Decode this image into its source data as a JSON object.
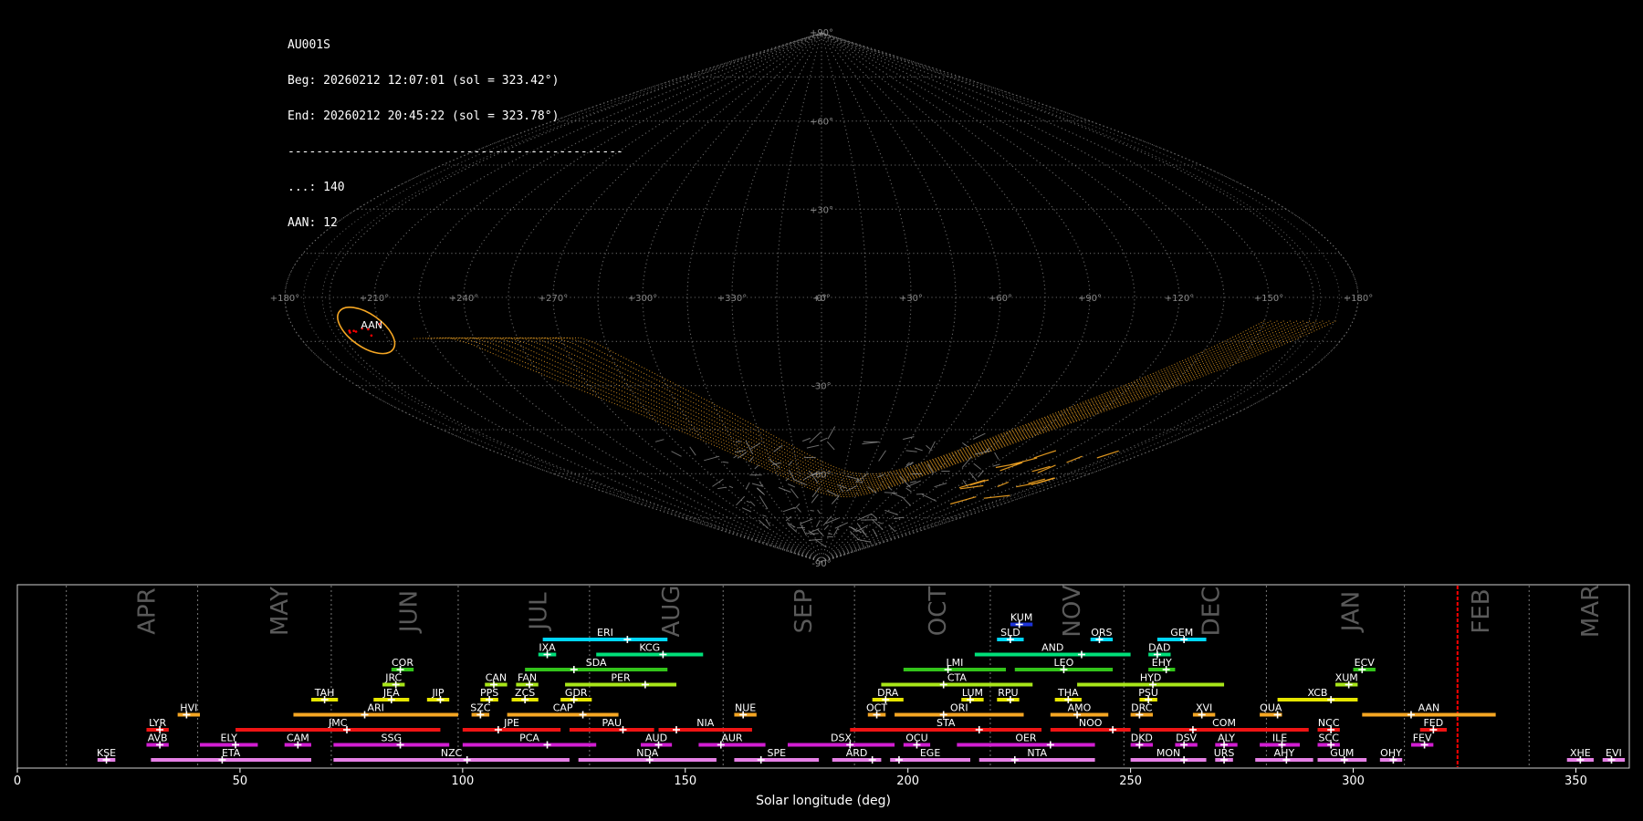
{
  "info": {
    "camera": "AU001S",
    "begin": "Beg: 20260212 12:07:01 (sol = 323.42°)",
    "end": "End: 20260212 20:45:22 (sol = 323.78°)",
    "separator": "-----------------------------------------------",
    "count_sporadic": "...: 140",
    "count_shower": "AAN: 12"
  },
  "chart_data": [
    {
      "type": "scatter",
      "projection": "sinusoidal",
      "grid": true,
      "lat_labels": [
        "+90°",
        "+60°",
        "+30°",
        "0°",
        "-30°",
        "-60°",
        "-90°"
      ],
      "lat_values": [
        90,
        60,
        30,
        0,
        -30,
        -60,
        -90
      ],
      "lon_labels": [
        "+180°",
        "+150°",
        "+120°",
        "+90°",
        "+60°",
        "+30°",
        "+0°",
        "+330°",
        "+300°",
        "+270°",
        "+240°",
        "+210°",
        "+180°"
      ],
      "lon_values": [
        180,
        150,
        120,
        90,
        60,
        30,
        0,
        330,
        300,
        270,
        240,
        210,
        180
      ],
      "radiant": {
        "label": "AAN",
        "lon": 165,
        "lat": -10,
        "color": "#ff0000",
        "ellipse_color": "#f5a623"
      },
      "colors": {
        "grid": "#888888",
        "sporadic": "#9a9a9a",
        "shower": "#f5a623"
      }
    },
    {
      "type": "timeline",
      "xlabel": "Solar longitude (deg)",
      "xlim": [
        0,
        362
      ],
      "xticks": [
        0,
        50,
        100,
        150,
        200,
        250,
        300,
        350
      ],
      "current_sol": 323.42,
      "current_color": "#ff0000",
      "months": [
        {
          "name": "APR",
          "sol": 11
        },
        {
          "name": "MAY",
          "sol": 40.5
        },
        {
          "name": "JUN",
          "sol": 70.5
        },
        {
          "name": "JUL",
          "sol": 99
        },
        {
          "name": "AUG",
          "sol": 128.5
        },
        {
          "name": "SEP",
          "sol": 158.5
        },
        {
          "name": "OCT",
          "sol": 188
        },
        {
          "name": "NOV",
          "sol": 218.5
        },
        {
          "name": "DEC",
          "sol": 248.5
        },
        {
          "name": "JAN",
          "sol": 280.5
        },
        {
          "name": "FEB",
          "sol": 311.5
        },
        {
          "name": "MAR",
          "sol": 339.5
        }
      ],
      "showers": [
        {
          "name": "KUM",
          "start": 223,
          "end": 228,
          "peak": 225,
          "row": 9,
          "color": "#1d33d9"
        },
        {
          "name": "ERI",
          "start": 118,
          "end": 146,
          "peak": 137,
          "row": 8,
          "color": "#00d7ff"
        },
        {
          "name": "SLD",
          "start": 220,
          "end": 226,
          "peak": 223,
          "row": 8,
          "color": "#00d7ff"
        },
        {
          "name": "ORS",
          "start": 241,
          "end": 246,
          "peak": 243,
          "row": 8,
          "color": "#00d7ff"
        },
        {
          "name": "GEM",
          "start": 256,
          "end": 267,
          "peak": 262,
          "row": 8,
          "color": "#00d7ff"
        },
        {
          "name": "IXA",
          "start": 117,
          "end": 121,
          "peak": 119,
          "row": 7,
          "color": "#00e07a"
        },
        {
          "name": "KCG",
          "start": 130,
          "end": 154,
          "peak": 145,
          "row": 7,
          "color": "#00e07a"
        },
        {
          "name": "AND",
          "start": 215,
          "end": 250,
          "peak": 239,
          "row": 7,
          "color": "#00e07a"
        },
        {
          "name": "DAD",
          "start": 254,
          "end": 259,
          "peak": 256,
          "row": 7,
          "color": "#00e07a"
        },
        {
          "name": "COR",
          "start": 84,
          "end": 89,
          "peak": 86,
          "row": 6,
          "color": "#33c41a"
        },
        {
          "name": "SDA",
          "start": 114,
          "end": 146,
          "peak": 125,
          "row": 6,
          "color": "#33c41a"
        },
        {
          "name": "LMI",
          "start": 199,
          "end": 222,
          "peak": 209,
          "row": 6,
          "color": "#33c41a"
        },
        {
          "name": "LEO",
          "start": 224,
          "end": 246,
          "peak": 235,
          "row": 6,
          "color": "#33c41a"
        },
        {
          "name": "EHY",
          "start": 254,
          "end": 260,
          "peak": 258,
          "row": 6,
          "color": "#33c41a"
        },
        {
          "name": "ECV",
          "start": 300,
          "end": 305,
          "peak": 302,
          "row": 6,
          "color": "#33c41a"
        },
        {
          "name": "JRC",
          "start": 82,
          "end": 87,
          "peak": 85,
          "row": 5,
          "color": "#a8e619"
        },
        {
          "name": "CAN",
          "start": 105,
          "end": 110,
          "peak": 107,
          "row": 5,
          "color": "#a8e619"
        },
        {
          "name": "FAN",
          "start": 112,
          "end": 117,
          "peak": 115,
          "row": 5,
          "color": "#a8e619"
        },
        {
          "name": "PER",
          "start": 123,
          "end": 148,
          "peak": 141,
          "row": 5,
          "color": "#a8e619"
        },
        {
          "name": "CTA",
          "start": 194,
          "end": 228,
          "peak": 208,
          "row": 5,
          "color": "#a8e619"
        },
        {
          "name": "HYD",
          "start": 238,
          "end": 271,
          "peak": 255,
          "row": 5,
          "color": "#a8e619"
        },
        {
          "name": "XUM",
          "start": 296,
          "end": 301,
          "peak": 299,
          "row": 5,
          "color": "#a8e619"
        },
        {
          "name": "TAH",
          "start": 66,
          "end": 72,
          "peak": 69,
          "row": 4,
          "color": "#e6e600"
        },
        {
          "name": "JEA",
          "start": 80,
          "end": 88,
          "peak": 84,
          "row": 4,
          "color": "#e6e600"
        },
        {
          "name": "JIP",
          "start": 92,
          "end": 97,
          "peak": 95,
          "row": 4,
          "color": "#e6e600"
        },
        {
          "name": "PPS",
          "start": 104,
          "end": 108,
          "peak": 106,
          "row": 4,
          "color": "#e6e600"
        },
        {
          "name": "ZCS",
          "start": 111,
          "end": 117,
          "peak": 114,
          "row": 4,
          "color": "#e6e600"
        },
        {
          "name": "GDR",
          "start": 122,
          "end": 129,
          "peak": 125,
          "row": 4,
          "color": "#e6e600"
        },
        {
          "name": "DRA",
          "start": 192,
          "end": 199,
          "peak": 195,
          "row": 4,
          "color": "#e6e600"
        },
        {
          "name": "LUM",
          "start": 212,
          "end": 217,
          "peak": 214,
          "row": 4,
          "color": "#e6e600"
        },
        {
          "name": "RPU",
          "start": 220,
          "end": 225,
          "peak": 223,
          "row": 4,
          "color": "#e6e600"
        },
        {
          "name": "THA",
          "start": 233,
          "end": 239,
          "peak": 236,
          "row": 4,
          "color": "#e6e600"
        },
        {
          "name": "PSU",
          "start": 252,
          "end": 256,
          "peak": 254,
          "row": 4,
          "color": "#e6e600"
        },
        {
          "name": "XCB",
          "start": 283,
          "end": 301,
          "peak": 295,
          "row": 4,
          "color": "#e6e600"
        },
        {
          "name": "HVI",
          "start": 36,
          "end": 41,
          "peak": 38,
          "row": 3,
          "color": "#f5a623"
        },
        {
          "name": "ARI",
          "start": 62,
          "end": 99,
          "peak": 78,
          "row": 3,
          "color": "#f5a623"
        },
        {
          "name": "SZC",
          "start": 102,
          "end": 106,
          "peak": 104,
          "row": 3,
          "color": "#f5a623"
        },
        {
          "name": "CAP",
          "start": 110,
          "end": 135,
          "peak": 127,
          "row": 3,
          "color": "#f5a623"
        },
        {
          "name": "NUE",
          "start": 161,
          "end": 166,
          "peak": 163,
          "row": 3,
          "color": "#f5a623"
        },
        {
          "name": "OCT",
          "start": 191,
          "end": 195,
          "peak": 193,
          "row": 3,
          "color": "#f5a623"
        },
        {
          "name": "ORI",
          "start": 197,
          "end": 226,
          "peak": 208,
          "row": 3,
          "color": "#f5a623"
        },
        {
          "name": "AMO",
          "start": 232,
          "end": 245,
          "peak": 238,
          "row": 3,
          "color": "#f5a623"
        },
        {
          "name": "DRC",
          "start": 250,
          "end": 255,
          "peak": 252,
          "row": 3,
          "color": "#f5a623"
        },
        {
          "name": "XVI",
          "start": 264,
          "end": 269,
          "peak": 266,
          "row": 3,
          "color": "#f5a623"
        },
        {
          "name": "QUA",
          "start": 279,
          "end": 284,
          "peak": 283,
          "row": 3,
          "color": "#f5a623"
        },
        {
          "name": "AAN",
          "start": 302,
          "end": 332,
          "peak": 313,
          "row": 3,
          "color": "#f5a623"
        },
        {
          "name": "LYR",
          "start": 29,
          "end": 34,
          "peak": 32,
          "row": 2,
          "color": "#f01414"
        },
        {
          "name": "JMC",
          "start": 49,
          "end": 95,
          "peak": 74,
          "row": 2,
          "color": "#f01414"
        },
        {
          "name": "JPE",
          "start": 100,
          "end": 122,
          "peak": 108,
          "row": 2,
          "color": "#f01414"
        },
        {
          "name": "PAU",
          "start": 124,
          "end": 143,
          "peak": 136,
          "row": 2,
          "color": "#f01414"
        },
        {
          "name": "NIA",
          "start": 144,
          "end": 165,
          "peak": 148,
          "row": 2,
          "color": "#f01414"
        },
        {
          "name": "STA",
          "start": 187,
          "end": 230,
          "peak": 216,
          "row": 2,
          "color": "#f01414"
        },
        {
          "name": "NOO",
          "start": 232,
          "end": 250,
          "peak": 246,
          "row": 2,
          "color": "#f01414"
        },
        {
          "name": "COM",
          "start": 252,
          "end": 290,
          "peak": 264,
          "row": 2,
          "color": "#f01414"
        },
        {
          "name": "NCC",
          "start": 292,
          "end": 297,
          "peak": 295,
          "row": 2,
          "color": "#f01414"
        },
        {
          "name": "FED",
          "start": 315,
          "end": 321,
          "peak": 318,
          "row": 2,
          "color": "#f01414"
        },
        {
          "name": "AVB",
          "start": 29,
          "end": 34,
          "peak": 32,
          "row": 1,
          "color": "#d21ed2"
        },
        {
          "name": "ELY",
          "start": 41,
          "end": 54,
          "peak": 49,
          "row": 1,
          "color": "#d21ed2"
        },
        {
          "name": "CAM",
          "start": 60,
          "end": 66,
          "peak": 63,
          "row": 1,
          "color": "#d21ed2"
        },
        {
          "name": "SSG",
          "start": 71,
          "end": 97,
          "peak": 86,
          "row": 1,
          "color": "#d21ed2"
        },
        {
          "name": "PCA",
          "start": 100,
          "end": 130,
          "peak": 119,
          "row": 1,
          "color": "#d21ed2"
        },
        {
          "name": "AUD",
          "start": 140,
          "end": 147,
          "peak": 144,
          "row": 1,
          "color": "#d21ed2"
        },
        {
          "name": "AUR",
          "start": 153,
          "end": 168,
          "peak": 158,
          "row": 1,
          "color": "#d21ed2"
        },
        {
          "name": "DSX",
          "start": 173,
          "end": 197,
          "peak": 187,
          "row": 1,
          "color": "#d21ed2"
        },
        {
          "name": "OCU",
          "start": 199,
          "end": 205,
          "peak": 202,
          "row": 1,
          "color": "#d21ed2"
        },
        {
          "name": "OER",
          "start": 211,
          "end": 242,
          "peak": 232,
          "row": 1,
          "color": "#d21ed2"
        },
        {
          "name": "DKD",
          "start": 250,
          "end": 255,
          "peak": 252,
          "row": 1,
          "color": "#d21ed2"
        },
        {
          "name": "DSV",
          "start": 260,
          "end": 265,
          "peak": 262,
          "row": 1,
          "color": "#d21ed2"
        },
        {
          "name": "ALY",
          "start": 269,
          "end": 274,
          "peak": 271,
          "row": 1,
          "color": "#d21ed2"
        },
        {
          "name": "ILE",
          "start": 279,
          "end": 288,
          "peak": 284,
          "row": 1,
          "color": "#d21ed2"
        },
        {
          "name": "SCC",
          "start": 292,
          "end": 297,
          "peak": 295,
          "row": 1,
          "color": "#d21ed2"
        },
        {
          "name": "FEV",
          "start": 313,
          "end": 318,
          "peak": 316,
          "row": 1,
          "color": "#d21ed2"
        },
        {
          "name": "KSE",
          "start": 18,
          "end": 22,
          "peak": 20,
          "row": 0,
          "color": "#e680e6"
        },
        {
          "name": "ETA",
          "start": 30,
          "end": 66,
          "peak": 46,
          "row": 0,
          "color": "#e680e6"
        },
        {
          "name": "NZC",
          "start": 71,
          "end": 124,
          "peak": 101,
          "row": 0,
          "color": "#e680e6"
        },
        {
          "name": "NDA",
          "start": 126,
          "end": 157,
          "peak": 142,
          "row": 0,
          "color": "#e680e6"
        },
        {
          "name": "SPE",
          "start": 161,
          "end": 180,
          "peak": 167,
          "row": 0,
          "color": "#e680e6"
        },
        {
          "name": "ARD",
          "start": 183,
          "end": 194,
          "peak": 192,
          "row": 0,
          "color": "#e680e6"
        },
        {
          "name": "EGE",
          "start": 196,
          "end": 214,
          "peak": 198,
          "row": 0,
          "color": "#e680e6"
        },
        {
          "name": "NTA",
          "start": 216,
          "end": 242,
          "peak": 224,
          "row": 0,
          "color": "#e680e6"
        },
        {
          "name": "MON",
          "start": 250,
          "end": 267,
          "peak": 262,
          "row": 0,
          "color": "#e680e6"
        },
        {
          "name": "URS",
          "start": 269,
          "end": 273,
          "peak": 271,
          "row": 0,
          "color": "#e680e6"
        },
        {
          "name": "AHY",
          "start": 278,
          "end": 291,
          "peak": 285,
          "row": 0,
          "color": "#e680e6"
        },
        {
          "name": "GUM",
          "start": 292,
          "end": 303,
          "peak": 298,
          "row": 0,
          "color": "#e680e6"
        },
        {
          "name": "OHY",
          "start": 306,
          "end": 311,
          "peak": 309,
          "row": 0,
          "color": "#e680e6"
        },
        {
          "name": "XHE",
          "start": 348,
          "end": 354,
          "peak": 351,
          "row": 0,
          "color": "#e680e6"
        },
        {
          "name": "EVI",
          "start": 356,
          "end": 361,
          "peak": 358,
          "row": 0,
          "color": "#e680e6"
        }
      ]
    }
  ]
}
